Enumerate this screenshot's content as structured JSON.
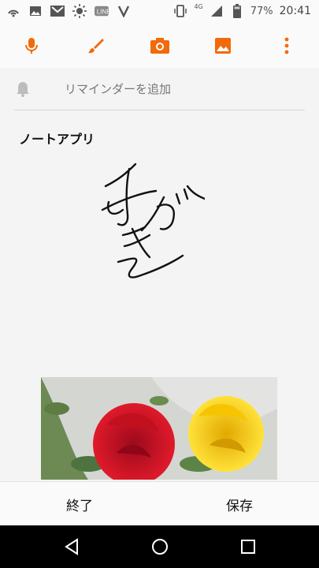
{
  "status_bar": {
    "icons_left": [
      "wifi-call-icon",
      "image-icon",
      "gmail-icon",
      "brightness-icon",
      "line-icon",
      "check-icon"
    ],
    "icons_right": [
      "vibrate-icon",
      "lte-signal-icon",
      "battery-icon"
    ],
    "network": "4G",
    "battery": "77%",
    "time": "20:41"
  },
  "toolbar": {
    "accent_color": "#f26a0a",
    "buttons": [
      "mic-icon",
      "brush-icon",
      "camera-icon",
      "image-icon",
      "more-vert-icon"
    ]
  },
  "reminder": {
    "label": "リマインダーを追加"
  },
  "note": {
    "title": "ノートアプリ"
  },
  "actions": {
    "finish": "終了",
    "save": "保存"
  },
  "navigation": [
    "back-icon",
    "home-icon",
    "recents-icon"
  ]
}
